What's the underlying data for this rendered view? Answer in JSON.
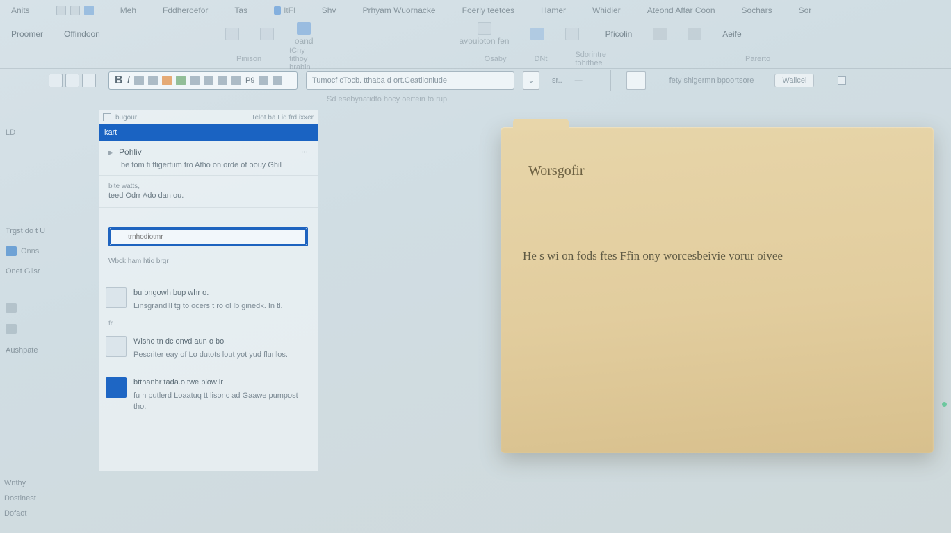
{
  "ribbon": {
    "tabs": [
      "Anits",
      "Meh",
      "Fddheroefor",
      "Tas",
      "Shv",
      "Prhyam Wuornacke",
      "Foerly teetces",
      "Hamer",
      "Whidier",
      "Ateond Affar Coon",
      "Sochars",
      "Sor"
    ],
    "row2": [
      "Proomer",
      "Offindoon",
      "oand",
      "avouioton fen",
      "Pficolin",
      "Aeife"
    ],
    "row3": [
      "Pinison",
      "tCny tithoy brabln",
      "Osaby",
      "DNt",
      "Sdorintre tohithee",
      "Parerto"
    ],
    "font_combo": "Tumocf cTocb.   tthaba d ort.Ceatiioniude",
    "hint": "Sd esebynatidto hocy oertein to rup.",
    "right": {
      "a": "fety shigermn bpoortsore",
      "b": "Walicel"
    }
  },
  "leftnav": {
    "items": [
      "LD",
      "",
      "",
      "",
      "Onns"
    ],
    "grp1": "Trgst do t U",
    "grp2": "Onet Glisr",
    "grp3": "Aushpate",
    "footer": [
      "Wnthy",
      "Dostinest",
      "Dofaot"
    ]
  },
  "list": {
    "header": "kart",
    "row1_title": "Pohliv",
    "row1_sub": "be fom fi ffigertum fro Atho on orde of oouy Ghil",
    "row2_cap": "bite watts,",
    "row2_line": "teed Odrr Ado dan ou.",
    "search_placeholder": "trnhodiotmr",
    "post_search_caption": "Wbck ham htio brgr",
    "items": [
      {
        "t": "bu bngowh bup whr o.",
        "s": "Linsgrandlll tg to ocers t ro ol lb ginedk. In tl."
      },
      {
        "t": "Wisho tn dc onvd aun o bol",
        "s": "Pescriter eay of Lo dutots lout yot yud flurllos."
      },
      {
        "t": "btthanbr tada.o  twe biow ir",
        "s": "fu n putlerd Loaatuq  tt lisonc ad Gaawe pumpost tho."
      }
    ]
  },
  "note": {
    "title": "Worsgofir",
    "body": "He s wi on fods ftes Ffin ony worcesbeivie vorur oivee"
  }
}
